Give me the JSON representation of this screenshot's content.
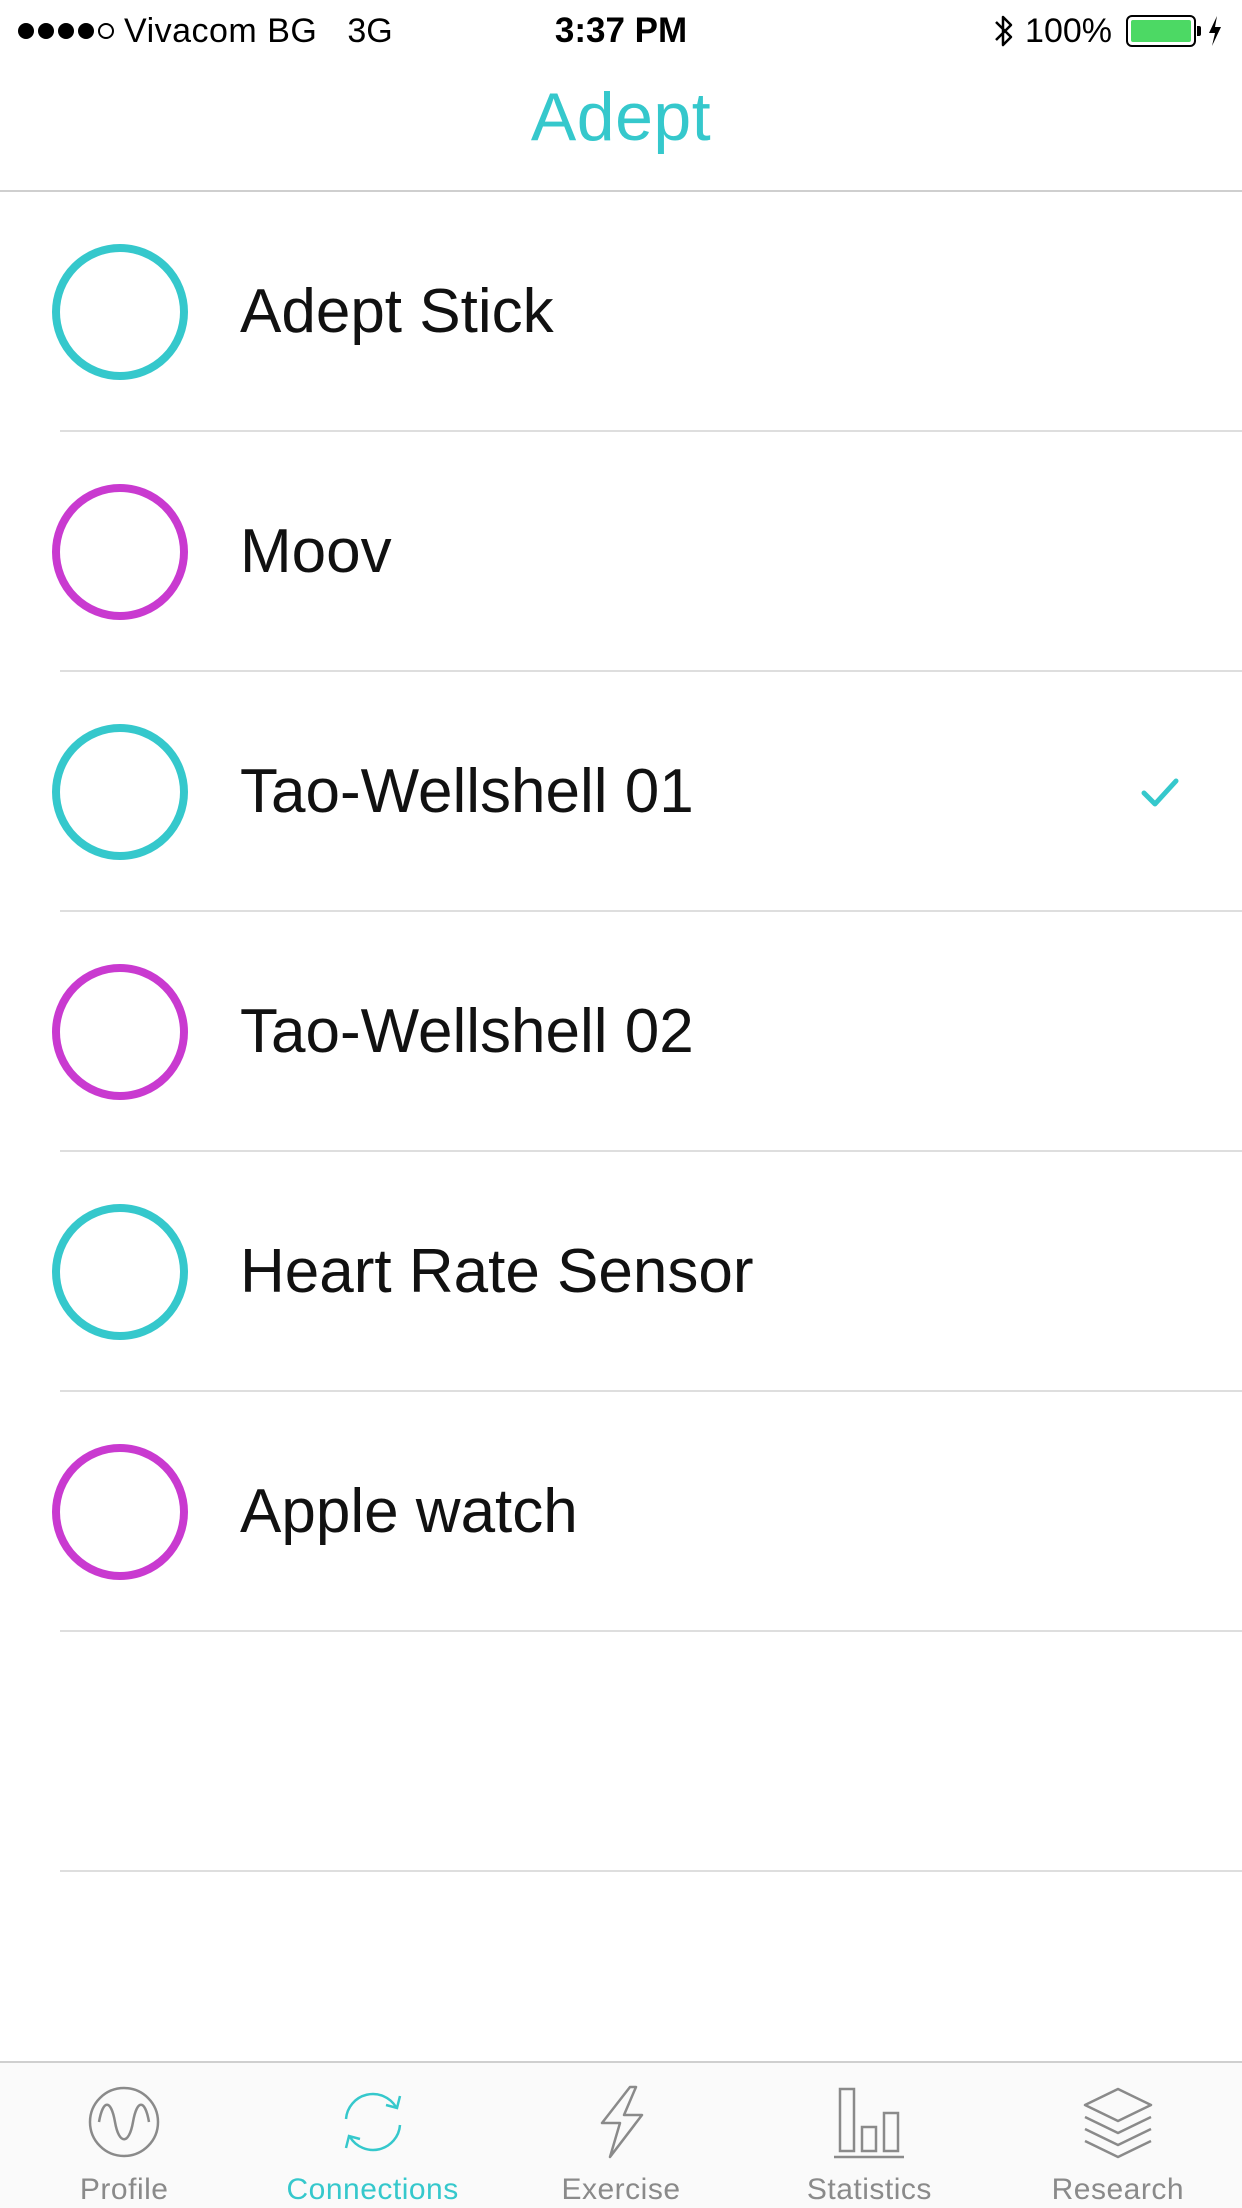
{
  "status_bar": {
    "carrier": "Vivacom BG",
    "network": "3G",
    "time": "3:37 PM",
    "battery": "100%",
    "battery_level": 1.0
  },
  "header": {
    "title": "Adept"
  },
  "devices": [
    {
      "name": "Adept Stick",
      "ring_color": "#35c8cc",
      "selected": false
    },
    {
      "name": "Moov",
      "ring_color": "#c93ad0",
      "selected": false
    },
    {
      "name": "Tao-Wellshell 01",
      "ring_color": "#35c8cc",
      "selected": true
    },
    {
      "name": "Tao-Wellshell 02",
      "ring_color": "#c93ad0",
      "selected": false
    },
    {
      "name": "Heart Rate Sensor",
      "ring_color": "#35c8cc",
      "selected": false
    },
    {
      "name": "Apple watch",
      "ring_color": "#c93ad0",
      "selected": false
    }
  ],
  "tabs": [
    {
      "label": "Profile",
      "icon": "wave-circle-icon",
      "active": false
    },
    {
      "label": "Connections",
      "icon": "sync-icon",
      "active": true
    },
    {
      "label": "Exercise",
      "icon": "lightning-icon",
      "active": false
    },
    {
      "label": "Statistics",
      "icon": "bar-chart-icon",
      "active": false
    },
    {
      "label": "Research",
      "icon": "layers-icon",
      "active": false
    }
  ],
  "colors": {
    "accent": "#35c8cc",
    "secondary": "#c93ad0",
    "inactive": "#8a8a8a"
  }
}
